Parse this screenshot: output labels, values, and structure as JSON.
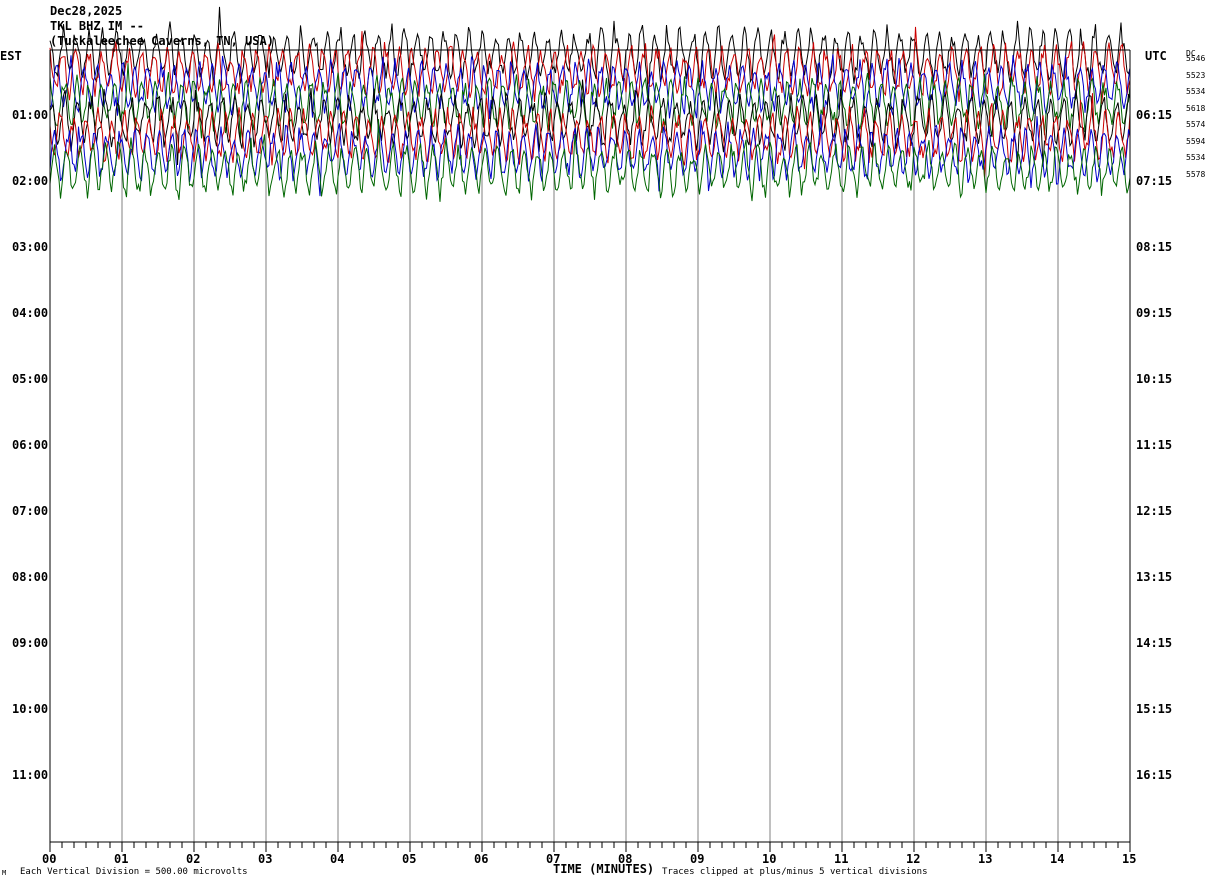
{
  "header": {
    "date": "Dec28,2025",
    "station": "TKL BHZ IM --",
    "location": "(Tuckaleechee Caverns, TN, USA)"
  },
  "left_axis_title": "EST",
  "right_axis_title": "UTC",
  "dc_label": "DC",
  "dc_values": [
    "5546",
    "5523",
    "5534",
    "5618",
    "5574",
    "5594",
    "5534",
    "5578"
  ],
  "footer": {
    "scale_note": "Each Vertical Division =  500.00 microvolts",
    "xaxis_label": "TIME (MINUTES)",
    "clip_note": "Traces clipped at plus/minus 5 vertical divisions",
    "corner_mark": "M"
  },
  "colors": {
    "trace_colors": [
      "#000000",
      "#cc0000",
      "#0000cc",
      "#006600"
    ],
    "grid": "#808080",
    "axis": "#000000"
  },
  "chart_data": {
    "type": "line",
    "description_type": "helicorder",
    "x_axis": {
      "label": "TIME (MINUTES)",
      "range": [
        0,
        15
      ],
      "tick_labels": [
        "00",
        "01",
        "02",
        "03",
        "04",
        "05",
        "06",
        "07",
        "08",
        "09",
        "10",
        "11",
        "12",
        "13",
        "14",
        "15"
      ]
    },
    "y_axis_left": {
      "label": "EST",
      "tick_labels": [
        "01:00",
        "02:00",
        "03:00",
        "04:00",
        "05:00",
        "06:00",
        "07:00",
        "08:00",
        "09:00",
        "10:00",
        "11:00"
      ]
    },
    "y_axis_right": {
      "label": "UTC",
      "tick_labels": [
        "06:15",
        "07:15",
        "08:15",
        "09:15",
        "10:15",
        "11:15",
        "12:15",
        "13:15",
        "14:15",
        "15:15",
        "16:15"
      ]
    },
    "rows_total": 48,
    "rows_per_hour": 4,
    "rows_with_data": 8,
    "trace_dc_offsets": [
      5546,
      5523,
      5534,
      5618,
      5574,
      5594,
      5534,
      5578
    ],
    "row_color_cycle": [
      "black",
      "red",
      "blue",
      "green"
    ],
    "grid": true
  }
}
